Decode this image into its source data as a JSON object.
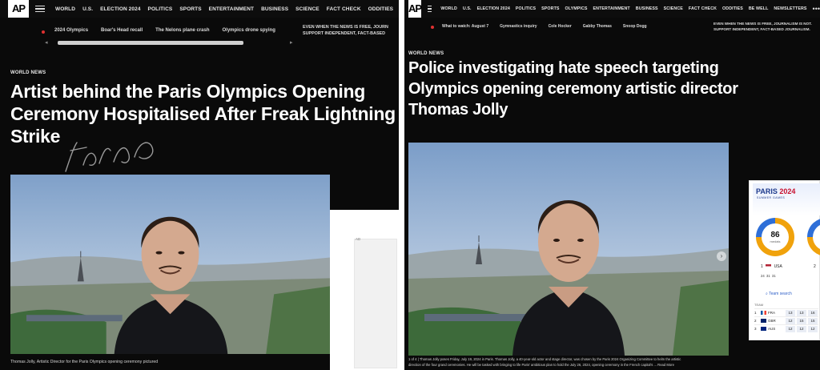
{
  "left": {
    "logo": "AP",
    "nav": [
      "WORLD",
      "U.S.",
      "ELECTION 2024",
      "POLITICS",
      "SPORTS",
      "ENTERTAINMENT",
      "BUSINESS",
      "SCIENCE",
      "FACT CHECK",
      "ODDITIES"
    ],
    "trending": [
      "2024 Olympics",
      "Boar's Head recall",
      "The Nelons plane crash",
      "Olympics drone spying"
    ],
    "promo_line1": "EVEN WHEN THE NEWS IS FREE, JOURN",
    "promo_line2": "SUPPORT INDEPENDENT, FACT-BASED",
    "kicker": "WORLD NEWS",
    "headline": "Artist behind the Paris Olympics Opening Ceremony Hospitalised After Freak Lightning Strike",
    "caption": "Thomas Jolly, Artistic Director for the Paris Olympics opening ceremony pictured",
    "ad_label": "AD"
  },
  "right": {
    "logo": "AP",
    "nav": [
      "WORLD",
      "U.S.",
      "ELECTION 2024",
      "POLITICS",
      "SPORTS",
      "OLYMPICS",
      "ENTERTAINMENT",
      "BUSINESS",
      "SCIENCE",
      "FACT CHECK",
      "ODDITIES",
      "BE WELL",
      "NEWSLETTERS"
    ],
    "more": "•••",
    "trending": [
      "What to watch: August 7",
      "Gymnastics inquiry",
      "Cole Hocker",
      "Gabby Thomas",
      "Snoop Dogg"
    ],
    "promo_line1": "EVEN WHEN THE NEWS IS FREE, JOURNALISM IS NOT.",
    "promo_line2": "SUPPORT INDEPENDENT, FACT-BASED JOURNALISM.",
    "kicker": "WORLD NEWS",
    "headline": "Police investigating hate speech targeting Olympics opening ceremony artistic director Thomas Jolly",
    "caption_line1": "1 of 4 | Thomas Jolly poses Friday, July 19, 2024 in Paris. Thomas Jolly, a 40-year-old actor and stage director, was chosen by the Paris 2024 Organizing Committee to helm the artistic",
    "caption_line2": "direction of the four grand ceremonies. He will be tasked with bringing to life Paris' ambitious plan to hold the July 26, 2024, opening ceremony in the French capital's ...  Read More",
    "widget": {
      "title_a": "PARIS",
      "title_b": "2024",
      "subtitle": "SUMMER GAMES",
      "medals_total": "86",
      "medals_label": "medals",
      "rank": "1",
      "country": "USA",
      "gold": "24",
      "silver": "31",
      "bronze": "31",
      "rank2": "2",
      "search_label": "Team search",
      "table_header": "TEAM",
      "rows": [
        {
          "rank": "1",
          "code": "FRA",
          "a": "13",
          "b": "13",
          "c": "16"
        },
        {
          "rank": "2",
          "code": "GBR",
          "a": "12",
          "b": "15",
          "c": "15"
        },
        {
          "rank": "3",
          "code": "AUS",
          "a": "12",
          "b": "12",
          "c": "12"
        }
      ]
    }
  }
}
